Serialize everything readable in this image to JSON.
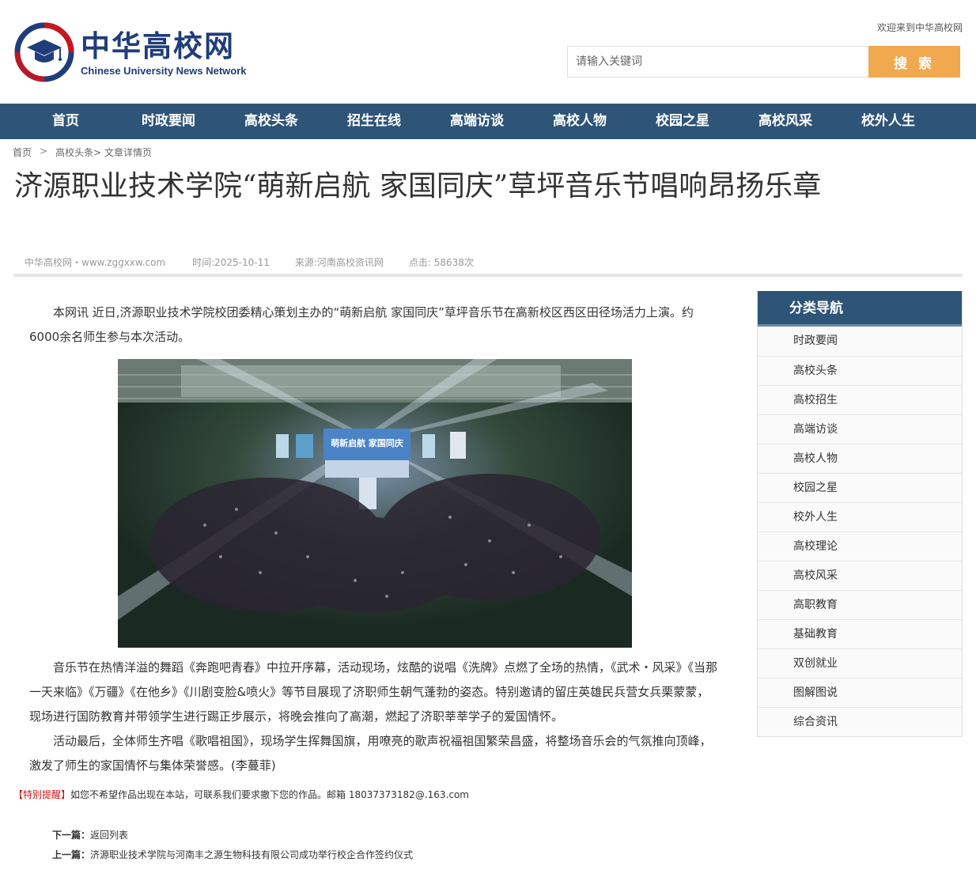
{
  "header": {
    "logo_cn": "中华高校网",
    "logo_en": "Chinese University News Network",
    "welcome": "欢迎来到中华高校网",
    "search_placeholder": "请输入关键词",
    "search_button": "搜 索"
  },
  "colors": {
    "nav_bg": "#2e5478",
    "search_button": "#f0a94f",
    "logo_blue": "#1f3d7a",
    "logo_red": "#c8161d",
    "notice_red": "#c8161d"
  },
  "nav": [
    {
      "label": "首页"
    },
    {
      "label": "时政要闻"
    },
    {
      "label": "高校头条"
    },
    {
      "label": "招生在线"
    },
    {
      "label": "高端访谈"
    },
    {
      "label": "高校人物"
    },
    {
      "label": "校园之星"
    },
    {
      "label": "高校风采"
    },
    {
      "label": "校外人生"
    }
  ],
  "breadcrumb": {
    "home": "首页",
    "separator": ">",
    "section": "高校头条",
    "current": "> 文章详情页"
  },
  "article": {
    "title": "济源职业技术学院“萌新启航 家国同庆”草坪音乐节唱响昂扬乐章",
    "meta": {
      "site": "中华高校网・www.zggxxw.com",
      "time": "时间:2025-10-11",
      "source": "来源:河南高校资讯网",
      "clicks": "点击: 58638次"
    },
    "paragraphs": [
      "本网讯  近日,济源职业技术学院校团委精心策划主办的“萌新启航 家国同庆”草坪音乐节在高新校区西区田径场活力上演。约6000余名师生参与本次活动。",
      "音乐节在热情洋溢的舞蹈《奔跑吧青春》中拉开序幕，活动现场，炫酷的说唱《洗牌》点燃了全场的热情，《武术・风采》《当那一天来临》《万疆》《在他乡》《川剧变脸&喷火》等节目展现了济职师生朝气蓬勃的姿态。特别邀请的留庄英雄民兵营女兵栗蒙蒙，现场进行国防教育并带领学生进行踢正步展示，将晚会推向了高潮，燃起了济职莘莘学子的爱国情怀。",
      "活动最后，全体师生齐唱《歌唱祖国》，现场学生挥舞国旗，用嘹亮的歌声祝福祖国繁荣昌盛，将整场音乐会的气氛推向顶峰，激发了师生的家国情怀与集体荣誉感。(李蔓菲)"
    ],
    "photo_sign": "萌新启航 家国同庆"
  },
  "notice": {
    "tag": "【特别提醒】",
    "text": "如您不希望作品出现在本站，可联系我们要求撤下您的作品。邮箱 18037373182@.163.com"
  },
  "pagination": {
    "next_label": "下一篇：",
    "next_title": "返回列表",
    "prev_label": "上一篇：",
    "prev_title": "济源职业技术学院与河南丰之源生物科技有限公司成功举行校企合作签约仪式"
  },
  "sidebar": {
    "heading": "分类导航",
    "items": [
      {
        "label": "时政要闻"
      },
      {
        "label": "高校头条"
      },
      {
        "label": "高校招生"
      },
      {
        "label": "高端访谈"
      },
      {
        "label": "高校人物"
      },
      {
        "label": "校园之星"
      },
      {
        "label": "校外人生"
      },
      {
        "label": "高校理论"
      },
      {
        "label": "高校风采"
      },
      {
        "label": "高职教育"
      },
      {
        "label": "基础教育"
      },
      {
        "label": "双创就业"
      },
      {
        "label": "图解图说"
      },
      {
        "label": "综合资讯"
      }
    ]
  }
}
